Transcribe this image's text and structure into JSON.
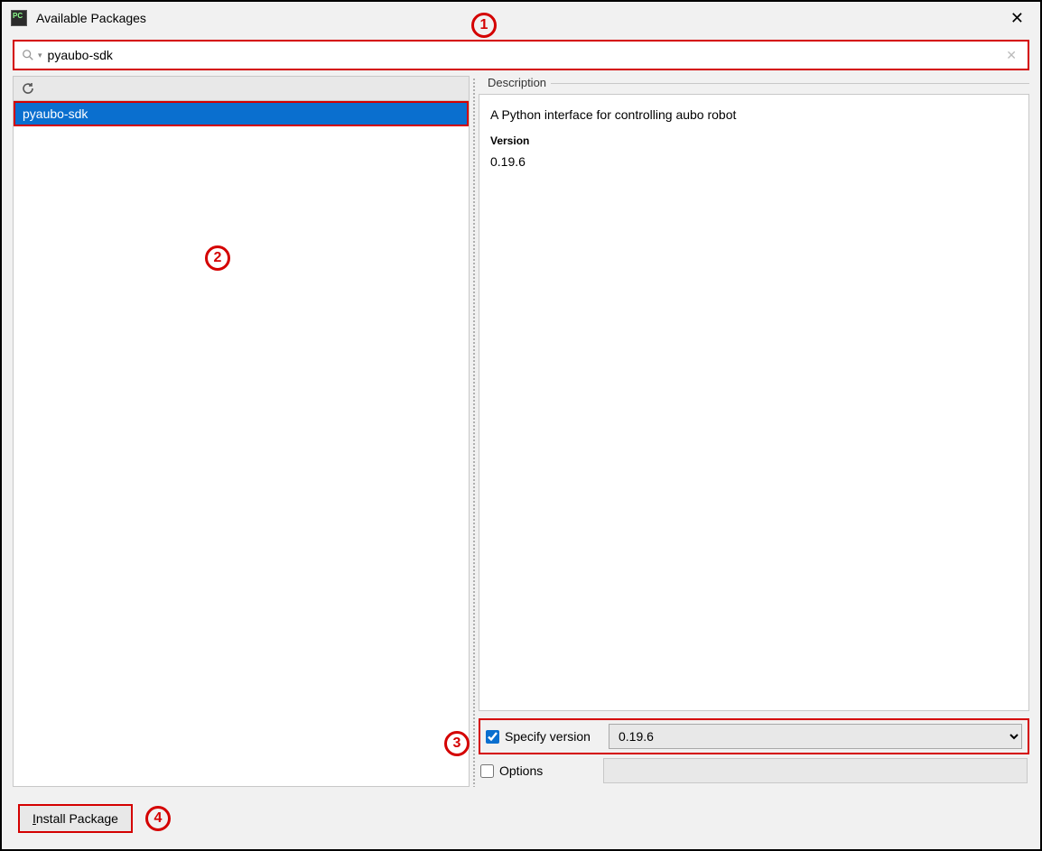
{
  "window": {
    "title": "Available Packages"
  },
  "search": {
    "value": "pyaubo-sdk"
  },
  "packages": {
    "items": [
      {
        "name": "pyaubo-sdk",
        "selected": true
      }
    ]
  },
  "description": {
    "legend": "Description",
    "summary": "A Python interface for controlling aubo robot",
    "version_label": "Version",
    "version_value": "0.19.6"
  },
  "specify": {
    "label": "Specify version",
    "checked": true,
    "selected": "0.19.6"
  },
  "options": {
    "label": "Options",
    "checked": false,
    "value": ""
  },
  "install": {
    "prefix": "I",
    "rest": "nstall Package"
  },
  "callouts": {
    "c1": "1",
    "c2": "2",
    "c3": "3",
    "c4": "4"
  }
}
